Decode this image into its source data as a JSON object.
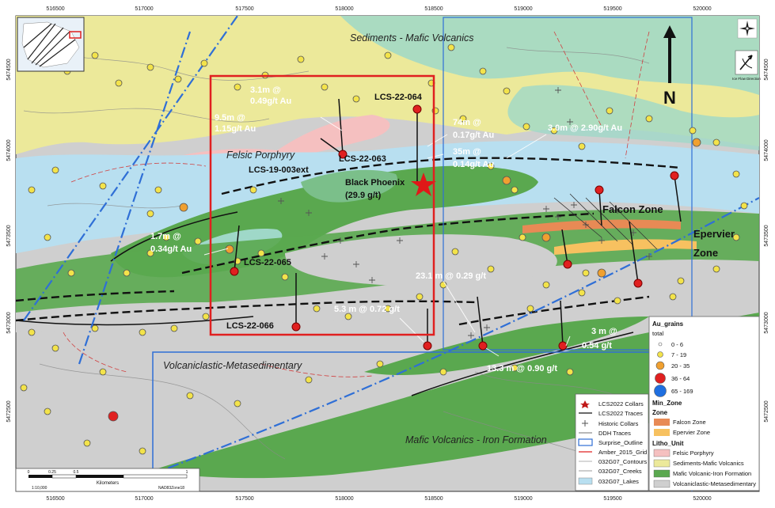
{
  "axes": {
    "x_ticks": [
      "516500",
      "517000",
      "517500",
      "518000",
      "518500",
      "519000",
      "519500",
      "520000"
    ],
    "y_ticks": [
      "5474500",
      "5474000",
      "5473500",
      "5473000",
      "5472500"
    ]
  },
  "litho_labels": {
    "sediments": "Sediments - Mafic Volcanics",
    "felsic": "Felsic Porphyry",
    "volcaniclastic": "Volcaniclastic-Metasedimentary",
    "mafic": "Mafic Volcanics - Iron Formation"
  },
  "annotations": {
    "a1": "3.1m @",
    "a1b": "0.49g/t Au",
    "a2": "9.5m @",
    "a2b": "1.15g/t Au",
    "a3": "74m @",
    "a3b": "0.17g/t Au",
    "a4": "35m @",
    "a4b": "0.14g/t Au",
    "a5": "3.0m @ 2.90g/t Au",
    "a6": "1.7m @",
    "a6b": "0.34g/t Au",
    "a7": "23.1 m @ 0.29 g/t",
    "a8": "5.3 m @ 0.72 g/t",
    "a9": "3 m @",
    "a9b": "0.54 g/t",
    "a10": "13.3 m @ 0.90 g/t"
  },
  "holes": {
    "h064": "LCS-22-064",
    "h063": "LCS-22-063",
    "h003": "LCS-19-003ext",
    "h065": "LCS-22-065",
    "h066": "LCS-22-066"
  },
  "black_phoenix": {
    "name": "Black Phoenix",
    "grade": "(29.9 g/t)"
  },
  "zones": {
    "falcon": "Falcon Zone",
    "epervier": "Epervier",
    "epervier2": "Zone"
  },
  "north": {
    "letter": "N"
  },
  "ice_flow": {
    "label": "Ice Flow Direction"
  },
  "scale": {
    "units": "Kilometers",
    "ratio": "1:10,000",
    "datum": "NAD83Zone18",
    "ticks": [
      "0",
      "0.25",
      "0.5",
      "1"
    ]
  },
  "legend_left": [
    {
      "label": "LCS2022 Collars"
    },
    {
      "label": "LCS2022 Traces"
    },
    {
      "label": "Historic Collars"
    },
    {
      "label": "DDH Traces"
    },
    {
      "label": "Surprise_Outline"
    },
    {
      "label": "Amber_2015_Grid"
    },
    {
      "label": "032G07_Contours"
    },
    {
      "label": "032G07_Creeks"
    },
    {
      "label": "032G07_Lakes"
    }
  ],
  "legend_right": {
    "au_title": "Au_grains",
    "au_sub": "total",
    "au_classes": [
      "0 - 6",
      "7 - 19",
      "20 - 35",
      "36 - 64",
      "65 - 169"
    ],
    "minzone_title": "Min_Zone",
    "minzone_sub": "Zone",
    "minzone_items": [
      "Falcon Zone",
      "Epervier Zone"
    ],
    "litho_title": "Litho_Unit",
    "litho_items": [
      "Felsic Porphyry",
      "Sediments-Mafic Volcanics",
      "Mafic Volcanic-Iron Formation",
      "Volcaniclastic-Metasedimentary"
    ]
  },
  "colors": {
    "yellow_unit": "#ece99a",
    "felsic": "#f5c0c0",
    "teal": "#9fd8c8",
    "lightblue": "#b8dff0",
    "green": "#5aa84f",
    "grey": "#cfcfcf",
    "falcon": "#e88a55",
    "epervier": "#f7c160",
    "red_box": "#e02020",
    "blue_line": "#2f6fd6"
  }
}
